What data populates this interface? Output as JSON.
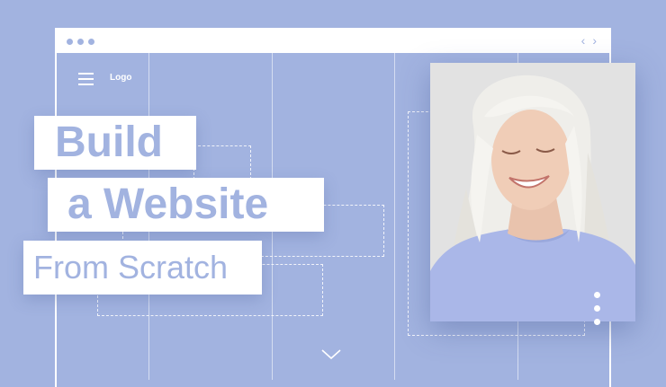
{
  "header": {
    "logo": "Logo"
  },
  "hero": {
    "line1": "Build",
    "line2": "a Website",
    "line3": "From Scratch"
  },
  "icons": {
    "menu": "hamburger-icon",
    "back": "chevron-left-icon",
    "forward": "chevron-right-icon",
    "scroll": "chevron-down-icon"
  },
  "nav": {
    "back_glyph": "‹",
    "forward_glyph": "›"
  },
  "colors": {
    "background": "#a2b3e0",
    "accent": "#ffffff"
  },
  "carousel": {
    "slides": 3
  }
}
